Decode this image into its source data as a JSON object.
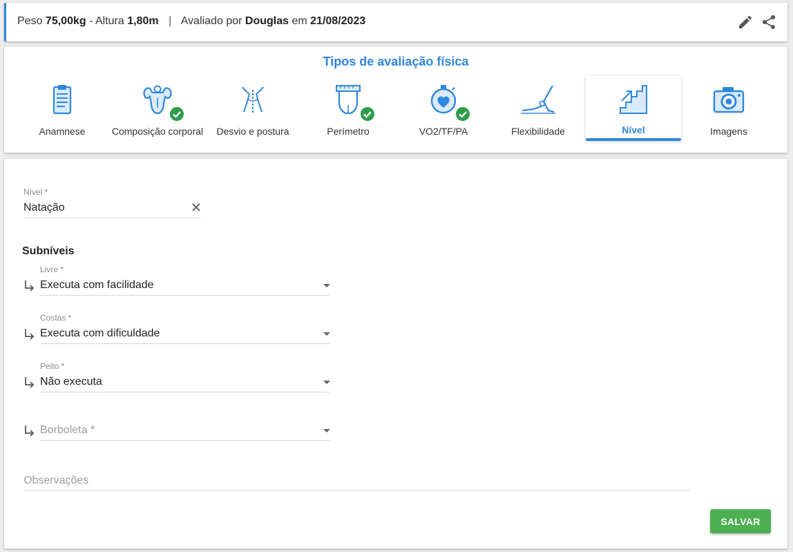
{
  "header": {
    "weight_label": "Peso",
    "weight_value": "75,00kg",
    "height_label": "- Altura",
    "height_value": "1,80m",
    "separator": "|",
    "evaluated_by_label": "Avaliado por",
    "evaluator": "Douglas",
    "date_label": "em",
    "date": "21/08/2023",
    "edit_icon": "pencil-icon",
    "share_icon": "share-icon"
  },
  "types": {
    "title": "Tipos de avaliação física",
    "items": [
      {
        "label": "Anamnese",
        "icon": "clipboard-icon",
        "completed": false,
        "active": false
      },
      {
        "label": "Composição corporal",
        "icon": "muscle-body-icon",
        "completed": true,
        "active": false
      },
      {
        "label": "Desvio e postura",
        "icon": "spine-posture-icon",
        "completed": false,
        "active": false
      },
      {
        "label": "Perímetro",
        "icon": "tape-measure-waist-icon",
        "completed": true,
        "active": false
      },
      {
        "label": "VO2/TF/PA",
        "icon": "heart-stopwatch-icon",
        "completed": true,
        "active": false
      },
      {
        "label": "Flexibilidade",
        "icon": "stretching-person-icon",
        "completed": false,
        "active": false
      },
      {
        "label": "Nível",
        "icon": "stairs-up-icon",
        "completed": false,
        "active": true
      },
      {
        "label": "Imagens",
        "icon": "camera-icon",
        "completed": false,
        "active": false
      }
    ]
  },
  "form": {
    "nivel": {
      "label": "Nível *",
      "value": "Natação"
    },
    "subniveis_title": "Subníveis",
    "subniveis": [
      {
        "label": "Livre *",
        "value": "Executa com facilidade"
      },
      {
        "label": "Costas *",
        "value": "Executa com dificuldade"
      },
      {
        "label": "Peito *",
        "value": "Não executa"
      },
      {
        "label": "",
        "value": "",
        "placeholder": "Borboleta *"
      }
    ],
    "observacoes_placeholder": "Observações",
    "save_label": "SALVAR"
  },
  "colors": {
    "accent": "#2f86dd",
    "success": "#4caf50",
    "check": "#2e9d4a"
  }
}
